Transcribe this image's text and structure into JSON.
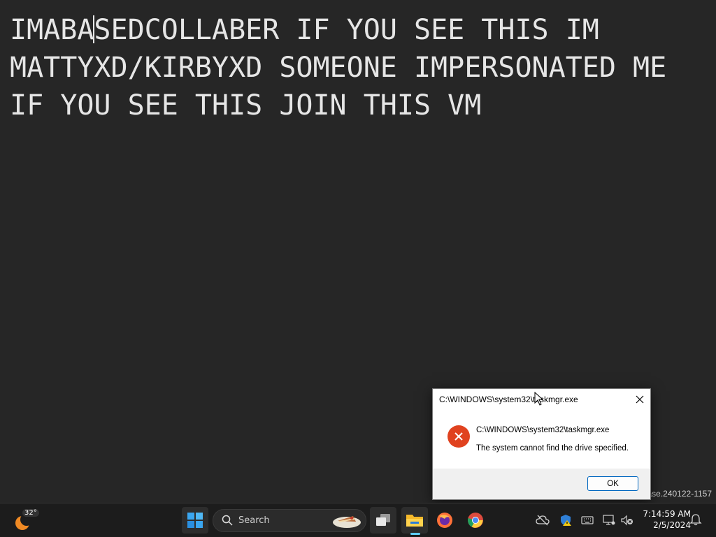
{
  "editor": {
    "lines": [
      "IMABASEDCOLLABER IF YOU SEE THIS IM",
      "MATTYXD/KIRBYXD SOMEONE IMPERSONATED ME",
      "IF YOU SEE THIS JOIN THIS VM"
    ],
    "line1_before_caret": "IMABA",
    "line1_after_caret": "SEDCOLLABER IF YOU SEE THIS IM"
  },
  "watermark": "ease.240122-1157",
  "dialog": {
    "title": "C:\\WINDOWS\\system32\\taskmgr.exe",
    "message_path": "C:\\WINDOWS\\system32\\taskmgr.exe",
    "message": "The system cannot find the drive specified.",
    "ok_label": "OK"
  },
  "taskbar": {
    "weather_temp": "32°",
    "search_label": "Search",
    "apps": [
      "start-icon",
      "search-icon",
      "task-view-icon",
      "file-explorer-icon",
      "firefox-icon",
      "chrome-icon"
    ],
    "clock_time": "7:14:59 AM",
    "clock_date": "2/5/2024"
  },
  "colors": {
    "desktop_bg": "#262626",
    "error_red": "#e0421f",
    "accent": "#60cdff"
  }
}
